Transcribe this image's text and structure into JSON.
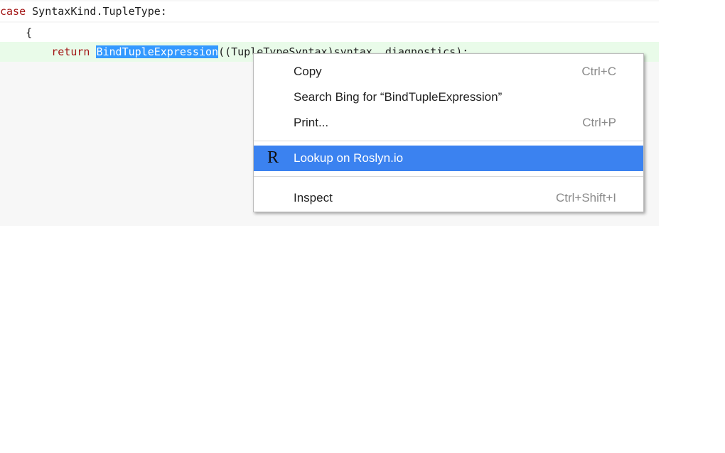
{
  "code": {
    "line1": {
      "keyword": "case",
      "rest": " SyntaxKind.TupleType:"
    },
    "line2": {
      "text": "    {"
    },
    "line3": {
      "indent": "        ",
      "keyword": "return",
      "space": " ",
      "selection": "BindTupleExpression",
      "rest": "((TupleTypeSyntax)syntax, diagnostics);"
    }
  },
  "context_menu": {
    "copy": {
      "label": "Copy",
      "shortcut": "Ctrl+C"
    },
    "search": {
      "label": "Search Bing for “BindTupleExpression”"
    },
    "print": {
      "label": "Print...",
      "shortcut": "Ctrl+P"
    },
    "lookup": {
      "label": "Lookup on Roslyn.io",
      "icon": "R"
    },
    "inspect": {
      "label": "Inspect",
      "shortcut": "Ctrl+Shift+I"
    }
  },
  "colors": {
    "selection": "#3399ff",
    "menu_highlight": "#3b82f0",
    "keyword": "#a31515",
    "line_highlight": "#e9fbe9"
  }
}
